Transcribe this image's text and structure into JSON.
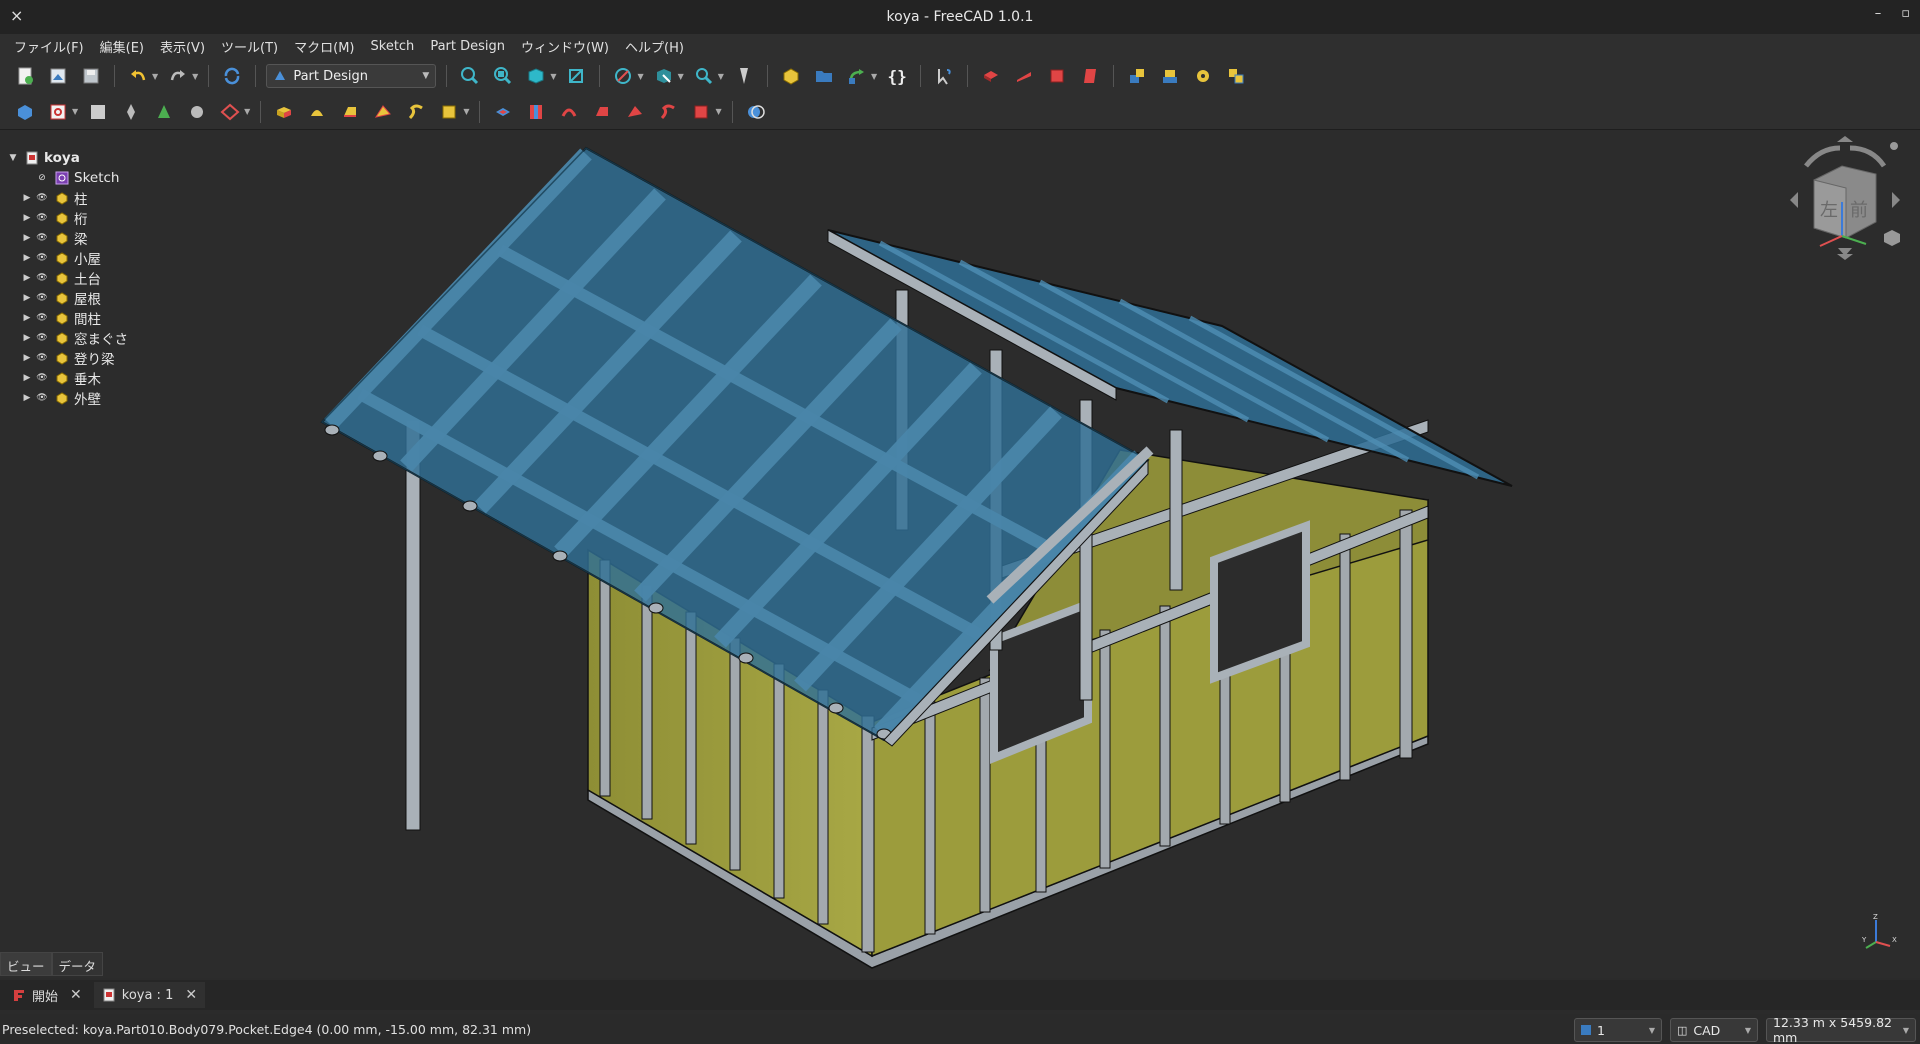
{
  "window": {
    "title": "koya - FreeCAD 1.0.1",
    "close_glyph": "×",
    "minimize_glyph": "–",
    "maximize_glyph": "▫"
  },
  "menu": [
    "ファイル(F)",
    "編集(E)",
    "表示(V)",
    "ツール(T)",
    "マクロ(M)",
    "Sketch",
    "Part Design",
    "ウィンドウ(W)",
    "ヘルプ(H)"
  ],
  "toolbar": {
    "workbench": "Part Design",
    "macro_braces": "{}"
  },
  "tree": {
    "root": "koya",
    "items": [
      {
        "label": "Sketch",
        "icon": "sketch-icon",
        "expandable": false
      },
      {
        "label": "柱",
        "icon": "part-icon",
        "expandable": true
      },
      {
        "label": "桁",
        "icon": "part-icon",
        "expandable": true
      },
      {
        "label": "梁",
        "icon": "part-icon",
        "expandable": true
      },
      {
        "label": "小屋",
        "icon": "part-icon",
        "expandable": true
      },
      {
        "label": "土台",
        "icon": "part-icon",
        "expandable": true
      },
      {
        "label": "屋根",
        "icon": "part-icon",
        "expandable": true
      },
      {
        "label": "間柱",
        "icon": "part-icon",
        "expandable": true
      },
      {
        "label": "窓まぐさ",
        "icon": "part-icon",
        "expandable": true
      },
      {
        "label": "登り梁",
        "icon": "part-icon",
        "expandable": true
      },
      {
        "label": "垂木",
        "icon": "part-icon",
        "expandable": true
      },
      {
        "label": "外壁",
        "icon": "part-icon",
        "expandable": true
      }
    ]
  },
  "navcube": {
    "face_front": "前",
    "face_left": "左"
  },
  "axis": {
    "z": "Z",
    "x": "X",
    "y": "Y"
  },
  "panel_tabs": [
    "ビュー",
    "データ"
  ],
  "doc_tabs": [
    {
      "label": "開始",
      "active": false
    },
    {
      "label": "koya : 1",
      "active": true
    }
  ],
  "status": {
    "message": "Preselected: koya.Part010.Body079.Pocket.Edge4 (0.00 mm, -15.00 mm, 82.31 mm)",
    "page": "1",
    "nav_style": "CAD",
    "dimensions": "12.33 m x 5459.82 mm"
  },
  "colors": {
    "accent": "#4a90d9",
    "wall": "#9a9a3a",
    "roof": "#2f6f95",
    "frame": "#a9b1b8"
  }
}
